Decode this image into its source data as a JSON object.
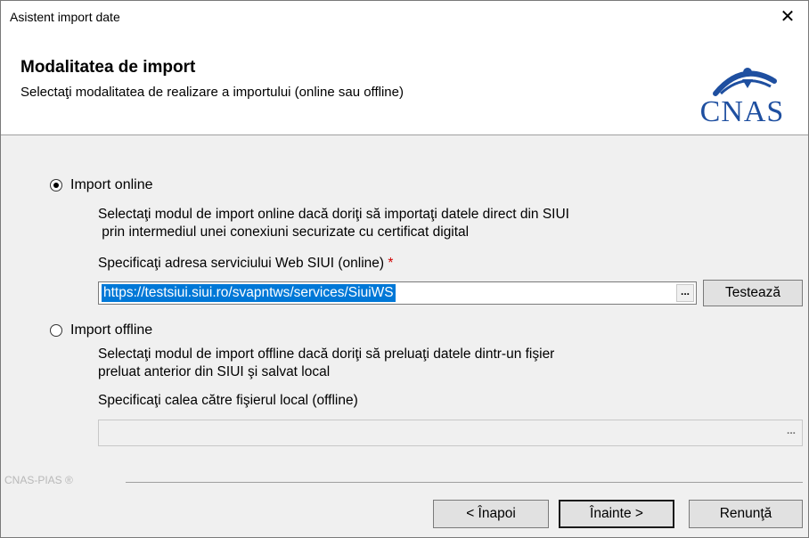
{
  "window": {
    "title": "Asistent import date",
    "close_glyph": "✕"
  },
  "header": {
    "title": "Modalitatea de import",
    "subtitle": "Selectaţi modalitatea de realizare a importului (online sau offline)",
    "logo_text": "CNAS",
    "logo_color": "#1e4fa0"
  },
  "online": {
    "label": "Import online",
    "selected": true,
    "description_line1": "Selectaţi modul de import online dacă doriţi să importaţi datele direct din SIUI",
    "description_line2": " prin intermediul unei conexiuni securizate cu certificat digital",
    "field_label": "Specificaţi adresa serviciului Web SIUI (online)",
    "required_mark": "*",
    "url_value": "https://testsiui.siui.ro/svapntws/services/SiuiWS",
    "browse_label": "...",
    "test_button": "Testează"
  },
  "offline": {
    "label": "Import offline",
    "selected": false,
    "description_line1": "Selectaţi modul de import offline dacă doriţi să preluaţi datele dintr-un fişier",
    "description_line2": "preluat anterior din SIUI şi salvat local",
    "field_label": "Specificaţi calea către fişierul local (offline)",
    "path_value": "",
    "browse_label": "..."
  },
  "footer": {
    "brand": "CNAS-PIAS ®",
    "back_button": "< Înapoi",
    "next_button": "Înainte >",
    "cancel_button": "Renunţă"
  }
}
